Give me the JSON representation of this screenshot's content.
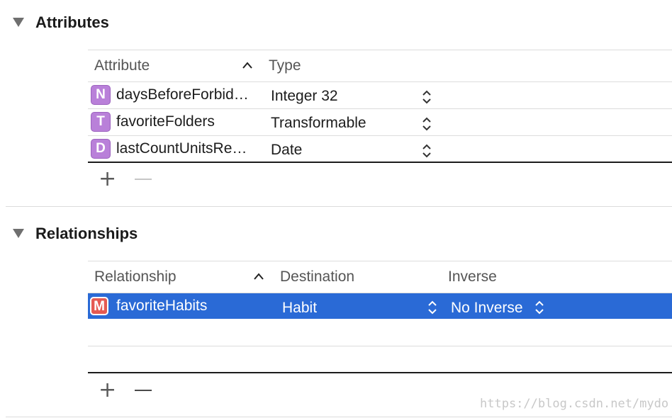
{
  "attributes": {
    "title": "Attributes",
    "columns": {
      "attribute": "Attribute",
      "type": "Type"
    },
    "rows": [
      {
        "badge": "N",
        "name": "daysBeforeForbid…",
        "type": "Integer 32"
      },
      {
        "badge": "T",
        "name": "favoriteFolders",
        "type": "Transformable"
      },
      {
        "badge": "D",
        "name": "lastCountUnitsRe…",
        "type": "Date"
      }
    ],
    "add_label": "+",
    "remove_label": "—"
  },
  "relationships": {
    "title": "Relationships",
    "columns": {
      "relationship": "Relationship",
      "destination": "Destination",
      "inverse": "Inverse"
    },
    "rows": [
      {
        "badge": "M",
        "name": "favoriteHabits",
        "destination": "Habit",
        "inverse": "No Inverse",
        "selected": true
      }
    ],
    "add_label": "+",
    "remove_label": "—"
  },
  "watermark": "https://blog.csdn.net/mydo",
  "colors": {
    "selection": "#2a6ad6",
    "badge_purple": "#b980d9",
    "badge_red": "#e55a52"
  }
}
